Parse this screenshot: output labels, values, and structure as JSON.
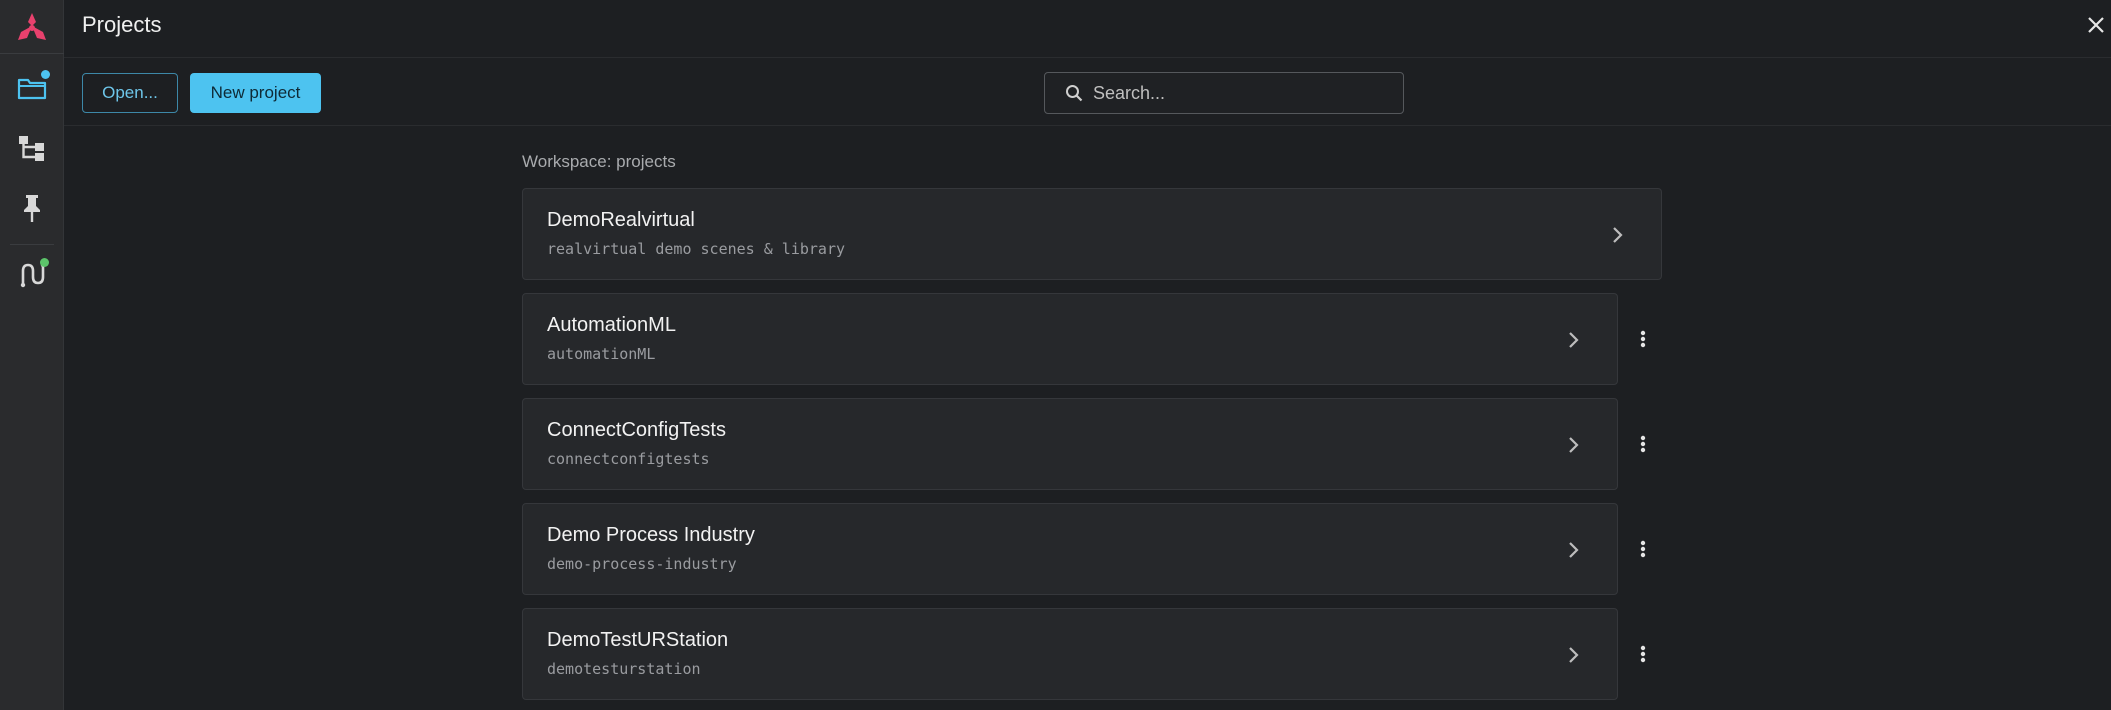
{
  "header": {
    "title": "Projects"
  },
  "rail": {
    "items": [
      {
        "icon": "folder-icon",
        "badge_color": "#4dc3f0",
        "active": true
      },
      {
        "icon": "hierarchy-icon"
      },
      {
        "icon": "pin-icon"
      },
      {
        "icon": "connection-icon",
        "badge_color": "#5cc46a"
      }
    ]
  },
  "toolbar": {
    "open_label": "Open...",
    "new_label": "New project",
    "search_placeholder": "Search..."
  },
  "workspace": {
    "label": "Workspace: projects"
  },
  "projects": [
    {
      "name": "DemoRealvirtual",
      "slug": "realvirtual demo scenes & library"
    },
    {
      "name": "AutomationML",
      "slug": "automationML"
    },
    {
      "name": "ConnectConfigTests",
      "slug": "connectconfigtests"
    },
    {
      "name": "Demo Process Industry",
      "slug": "demo-process-industry"
    },
    {
      "name": "DemoTestURStation",
      "slug": "demotesturstation"
    }
  ],
  "colors": {
    "accent": "#4dc3f0",
    "logo": "#e8416d",
    "status_green": "#5cc46a"
  }
}
